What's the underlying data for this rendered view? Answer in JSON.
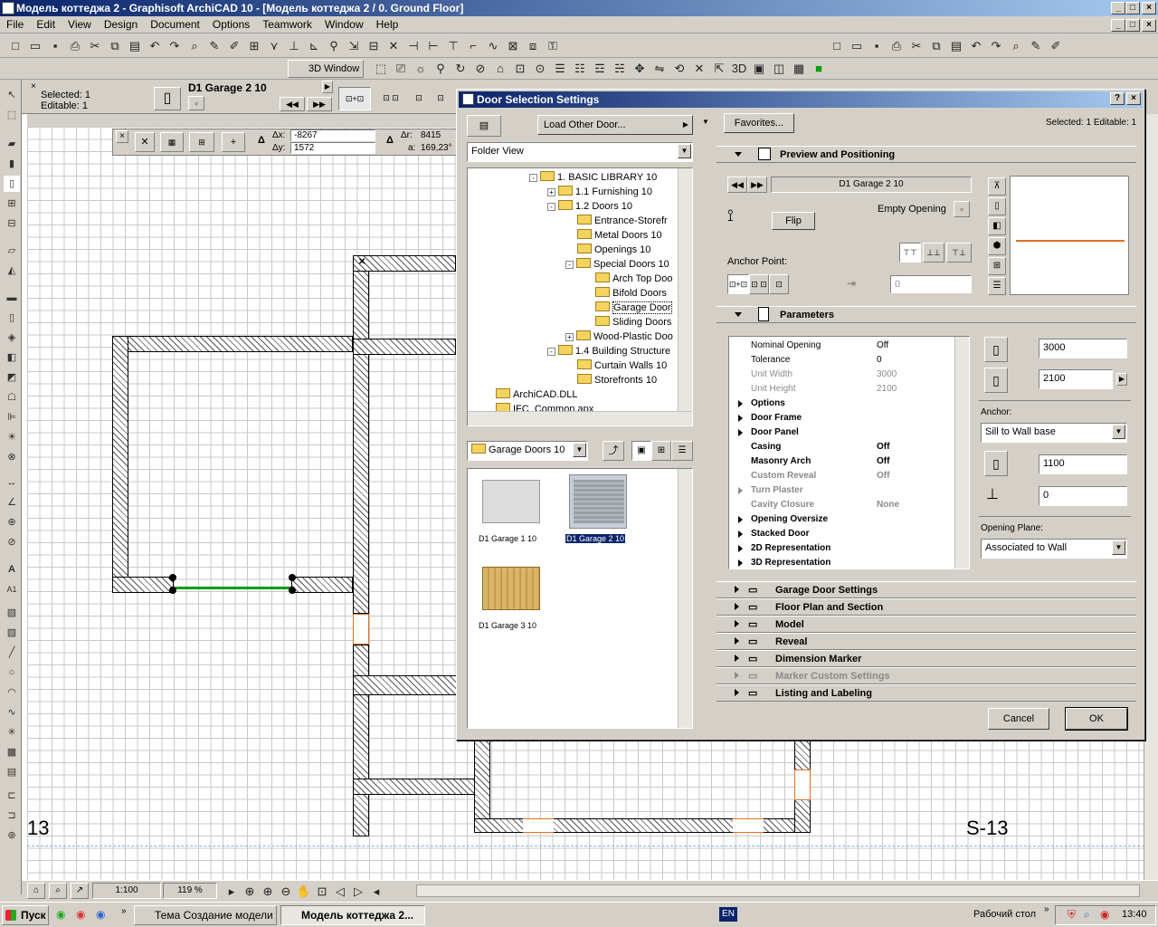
{
  "window": {
    "title": "Модель коттеджа 2 - Graphisoft ArchiCAD 10 - [Модель коттеджа 2 / 0. Ground Floor]"
  },
  "menu": [
    "File",
    "Edit",
    "View",
    "Design",
    "Document",
    "Options",
    "Teamwork",
    "Window",
    "Help"
  ],
  "toolbar2": {
    "threed_window": "3D Window"
  },
  "infobox": {
    "selected": "Selected: 1",
    "editable": "Editable: 1",
    "door_name": "D1 Garage 2 10"
  },
  "coords": {
    "dx_label": "Δx:",
    "dx": "-8267",
    "dy_label": "Δy:",
    "dy": "1572",
    "dr_label": "Δr:",
    "dr": "8415",
    "a_label": "a:",
    "a": "169,23°"
  },
  "plan": {
    "grid_label_left": "13",
    "grid_label_right": "S-13"
  },
  "dialog": {
    "title": "Door Selection Settings",
    "load_other": "Load Other Door...",
    "folder_view": "Folder View",
    "favorites": "Favorites...",
    "selected_info": "Selected: 1 Editable: 1",
    "tree": [
      {
        "label": "1. BASIC LIBRARY 10",
        "indent": 0,
        "exp": "-"
      },
      {
        "label": "1.1 Furnishing 10",
        "indent": 1,
        "exp": "+"
      },
      {
        "label": "1.2 Doors 10",
        "indent": 1,
        "exp": "-"
      },
      {
        "label": "Entrance-Storefr",
        "indent": 2,
        "exp": ""
      },
      {
        "label": "Metal Doors 10",
        "indent": 2,
        "exp": ""
      },
      {
        "label": "Openings 10",
        "indent": 2,
        "exp": ""
      },
      {
        "label": "Special Doors 10",
        "indent": 2,
        "exp": "-"
      },
      {
        "label": "Arch Top Doo",
        "indent": 3,
        "exp": ""
      },
      {
        "label": "Bifold Doors",
        "indent": 3,
        "exp": ""
      },
      {
        "label": "Garage Door",
        "indent": 3,
        "exp": ""
      },
      {
        "label": "Sliding Doors",
        "indent": 3,
        "exp": ""
      },
      {
        "label": "Wood-Plastic Doo",
        "indent": 2,
        "exp": "+"
      },
      {
        "label": "1.4 Building Structure",
        "indent": 1,
        "exp": "-"
      },
      {
        "label": "Curtain Walls 10",
        "indent": 2,
        "exp": ""
      },
      {
        "label": "Storefronts 10",
        "indent": 2,
        "exp": ""
      },
      {
        "label": "ArchiCAD.DLL",
        "indent": -1,
        "exp": ""
      },
      {
        "label": "IFC_Common.apx",
        "indent": -1,
        "exp": ""
      }
    ],
    "current_folder": "Garage Doors 10",
    "thumbs": [
      {
        "label": "D1 Garage 1 10",
        "selected": false,
        "color": "#dcdcdc"
      },
      {
        "label": "D1 Garage 2 10",
        "selected": true,
        "color": "#9aa0a6"
      },
      {
        "label": "D1 Garage 3 10",
        "selected": false,
        "color": "#d9b56a"
      }
    ],
    "preview": {
      "header": "Preview and Positioning",
      "door_name": "D1 Garage 2 10",
      "empty_opening": "Empty Opening",
      "flip": "Flip",
      "anchor_point": "Anchor Point:",
      "offset_value": "0"
    },
    "parameters": {
      "header": "Parameters",
      "rows": [
        {
          "name": "Nominal Opening",
          "value": "Off",
          "bold": false,
          "dim": false,
          "expand": false
        },
        {
          "name": "Tolerance",
          "value": "0",
          "bold": false,
          "dim": false,
          "expand": false
        },
        {
          "name": "Unit Width",
          "value": "3000",
          "bold": false,
          "dim": true,
          "expand": false
        },
        {
          "name": "Unit Height",
          "value": "2100",
          "bold": false,
          "dim": true,
          "expand": false
        },
        {
          "name": "Options",
          "value": "",
          "bold": true,
          "dim": false,
          "expand": true
        },
        {
          "name": "Door Frame",
          "value": "",
          "bold": true,
          "dim": false,
          "expand": true
        },
        {
          "name": "Door Panel",
          "value": "",
          "bold": true,
          "dim": false,
          "expand": true
        },
        {
          "name": "Casing",
          "value": "Off",
          "bold": true,
          "dim": false,
          "expand": false
        },
        {
          "name": "Masonry Arch",
          "value": "Off",
          "bold": true,
          "dim": false,
          "expand": false
        },
        {
          "name": "Custom Reveal",
          "value": "Off",
          "bold": true,
          "dim": true,
          "expand": false
        },
        {
          "name": "Turn Plaster",
          "value": "",
          "bold": true,
          "dim": true,
          "expand": true
        },
        {
          "name": "Cavity Closure",
          "value": "None",
          "bold": true,
          "dim": true,
          "expand": false
        },
        {
          "name": "Opening Oversize",
          "value": "",
          "bold": true,
          "dim": false,
          "expand": true
        },
        {
          "name": "Stacked Door",
          "value": "",
          "bold": true,
          "dim": false,
          "expand": true
        },
        {
          "name": "2D Representation",
          "value": "",
          "bold": true,
          "dim": false,
          "expand": true
        },
        {
          "name": "3D Representation",
          "value": "",
          "bold": true,
          "dim": false,
          "expand": true
        }
      ],
      "width": "3000",
      "height": "2100",
      "anchor_label": "Anchor:",
      "anchor_value": "Sill to Wall base",
      "sill": "1100",
      "offset": "0",
      "plane_label": "Opening Plane:",
      "plane_value": "Associated to Wall"
    },
    "sections": [
      {
        "label": "Garage Door Settings",
        "dim": false
      },
      {
        "label": "Floor Plan and Section",
        "dim": false
      },
      {
        "label": "Model",
        "dim": false
      },
      {
        "label": "Reveal",
        "dim": false
      },
      {
        "label": "Dimension Marker",
        "dim": false
      },
      {
        "label": "Marker Custom Settings",
        "dim": true
      },
      {
        "label": "Listing and Labeling",
        "dim": false
      }
    ],
    "cancel": "Cancel",
    "ok": "OK"
  },
  "statusbar": {
    "scale": "1:100",
    "zoom": "119 %"
  },
  "taskbar": {
    "start": "Пуск",
    "task1": "Тема Создание модели ...",
    "task2": "Модель коттеджа 2...",
    "lang": "EN",
    "desktop": "Рабочий стол",
    "clock": "13:40"
  },
  "colors": {
    "titlebar": "#0a246a",
    "selection": "#0a246a",
    "wall_green": "#00a000",
    "opening_orange": "#e07020"
  }
}
